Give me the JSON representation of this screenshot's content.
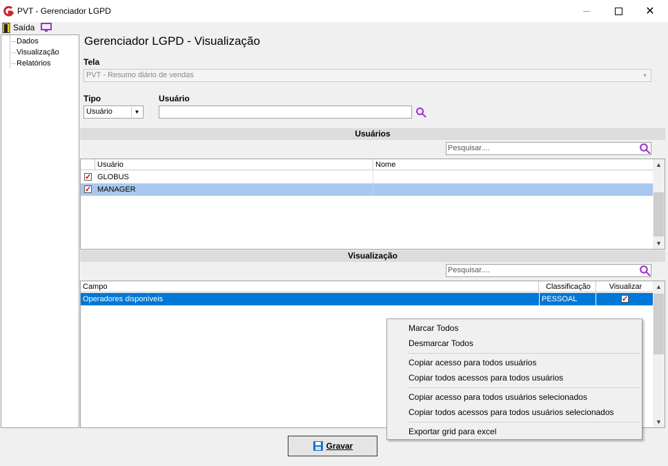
{
  "window": {
    "title": "PVT - Gerenciador LGPD"
  },
  "toolbar": {
    "exit_label": "Saída"
  },
  "tree": {
    "items": [
      "Dados",
      "Visualização",
      "Relatórios"
    ]
  },
  "main": {
    "heading": "Gerenciador LGPD - Visualização",
    "tela_label": "Tela",
    "tela_value": "PVT - Resumo diário de vendas",
    "tipo_label": "Tipo",
    "tipo_value": "Usuário",
    "usuario_label": "Usuário",
    "usuario_value": ""
  },
  "usuarios_section": {
    "title": "Usuários",
    "search_placeholder": "Pesquisar....",
    "columns": [
      "Usuário",
      "Nome"
    ],
    "rows": [
      {
        "usuario": "GLOBUS",
        "nome": "",
        "checked": true
      },
      {
        "usuario": "MANAGER",
        "nome": "",
        "checked": true
      }
    ]
  },
  "visualizacao_section": {
    "title": "Visualização",
    "search_placeholder": "Pesquisar....",
    "columns": [
      "Campo",
      "Classificação",
      "Visualizar"
    ],
    "rows": [
      {
        "campo": "Operadores disponíveis",
        "classificacao": "PESSOAL",
        "visualizar": true
      }
    ]
  },
  "context_menu": {
    "items": [
      "Marcar Todos",
      "Desmarcar Todos",
      "Copiar acesso para todos usuários",
      "Copiar todos acessos para todos usuários",
      "Copiar acesso para todos usuários selecionados",
      "Copiar todos acessos para todos usuários selecionados",
      "Exportar grid para excel"
    ]
  },
  "footer": {
    "save_label": "Gravar"
  },
  "colors": {
    "selection": "#0078d7",
    "row_highlight": "#a8c8ef",
    "accent": "#9b30d0",
    "logo": "#d0202a"
  }
}
